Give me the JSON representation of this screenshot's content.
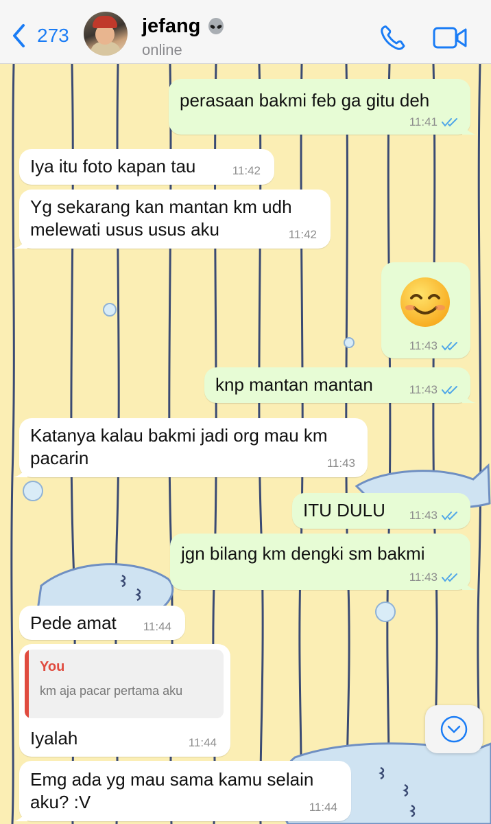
{
  "header": {
    "back_count": "273",
    "contact_name": "jefang",
    "status": "online"
  },
  "icons": {
    "accent": "#1a7cf5",
    "back": "chevron-left-icon",
    "alien": "alien-emoji",
    "call": "phone-icon",
    "video": "video-camera-icon",
    "scroll": "chevron-down-icon"
  },
  "colors": {
    "incoming_bubble": "#ffffff",
    "outgoing_bubble": "#e7fcd5",
    "wallpaper": "#fbeeb4",
    "read_ticks": "#4fa6e8",
    "quote_author": "#e04b3f"
  },
  "messages": [
    {
      "dir": "out",
      "text": "perasaan bakmi feb ga gitu deh",
      "time": "11:41"
    },
    {
      "dir": "in",
      "text": "Iya itu foto kapan tau",
      "time": "11:42"
    },
    {
      "dir": "in",
      "line1": "Yg sekarang kan mantan km udh",
      "line2": "melewati usus usus aku",
      "time": "11:42"
    },
    {
      "dir": "out",
      "emoji": "😊",
      "time": "11:43"
    },
    {
      "dir": "out",
      "text": "knp mantan mantan",
      "time": "11:43"
    },
    {
      "dir": "in",
      "line1": "Katanya kalau bakmi jadi org mau km",
      "line2": "pacarin",
      "time": "11:43"
    },
    {
      "dir": "out",
      "text": "ITU DULU",
      "time": "11:43"
    },
    {
      "dir": "out",
      "text": "jgn bilang km dengki sm bakmi",
      "time": "11:43"
    },
    {
      "dir": "in",
      "text": "Pede amat",
      "time": "11:44"
    },
    {
      "dir": "in",
      "quote_author": "You",
      "quote_text": "km aja pacar pertama aku",
      "text": "Iyalah",
      "time": "11:44"
    },
    {
      "dir": "in",
      "line1": "Emg ada yg mau sama kamu selain",
      "line2": "aku? :V",
      "time": "11:44"
    }
  ]
}
